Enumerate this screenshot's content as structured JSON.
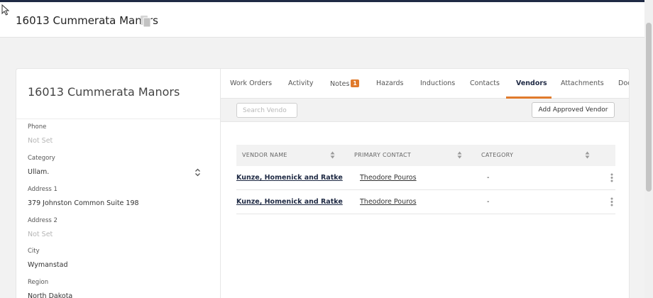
{
  "header": {
    "title": "16013 Cummerata Manors"
  },
  "property": {
    "title": "16013 Cummerata Manors",
    "fields": [
      {
        "label": "Phone",
        "value": "Not Set",
        "empty": true
      },
      {
        "label": "Category",
        "value": "Ullam.",
        "empty": false
      },
      {
        "label": "Address 1",
        "value": "379 Johnston Common Suite 198",
        "empty": false
      },
      {
        "label": "Address 2",
        "value": "Not Set",
        "empty": true
      },
      {
        "label": "City",
        "value": "Wymanstad",
        "empty": false
      },
      {
        "label": "Region",
        "value": "North Dakota",
        "empty": false
      }
    ]
  },
  "tabs": [
    {
      "label": "Work Orders"
    },
    {
      "label": "Activity"
    },
    {
      "label": "Notes",
      "badge": "1"
    },
    {
      "label": "Hazards"
    },
    {
      "label": "Inductions"
    },
    {
      "label": "Contacts"
    },
    {
      "label": "Vendors",
      "active": true
    },
    {
      "label": "Attachments"
    },
    {
      "label": "Doc"
    }
  ],
  "toolbar": {
    "search_placeholder": "Search Vendo",
    "add_label": "Add Approved Vendor"
  },
  "table": {
    "columns": [
      "VENDOR NAME",
      "PRIMARY CONTACT",
      "CATEGORY"
    ],
    "rows": [
      {
        "vendor": "Kunze, Homenick and Ratke",
        "contact": "Theodore Pouros",
        "category": "-"
      },
      {
        "vendor": "Kunze, Homenick and Ratke",
        "contact": "Theodore Pouros",
        "category": "-"
      }
    ]
  },
  "colors": {
    "accent": "#e07a2c",
    "navy": "#1f2a44"
  }
}
